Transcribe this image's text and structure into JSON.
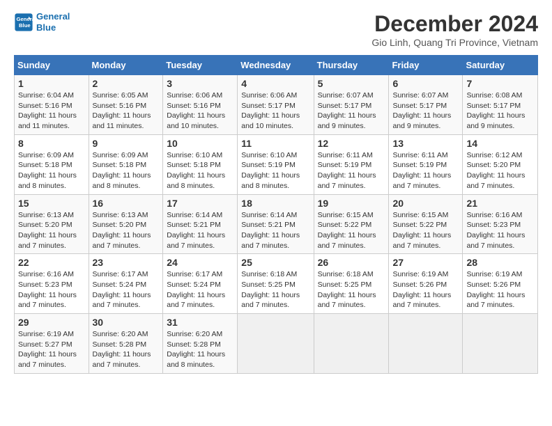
{
  "header": {
    "logo_line1": "General",
    "logo_line2": "Blue",
    "title": "December 2024",
    "subtitle": "Gio Linh, Quang Tri Province, Vietnam"
  },
  "weekdays": [
    "Sunday",
    "Monday",
    "Tuesday",
    "Wednesday",
    "Thursday",
    "Friday",
    "Saturday"
  ],
  "weeks": [
    [
      {
        "day": "1",
        "detail": "Sunrise: 6:04 AM\nSunset: 5:16 PM\nDaylight: 11 hours and 11 minutes."
      },
      {
        "day": "2",
        "detail": "Sunrise: 6:05 AM\nSunset: 5:16 PM\nDaylight: 11 hours and 11 minutes."
      },
      {
        "day": "3",
        "detail": "Sunrise: 6:06 AM\nSunset: 5:16 PM\nDaylight: 11 hours and 10 minutes."
      },
      {
        "day": "4",
        "detail": "Sunrise: 6:06 AM\nSunset: 5:17 PM\nDaylight: 11 hours and 10 minutes."
      },
      {
        "day": "5",
        "detail": "Sunrise: 6:07 AM\nSunset: 5:17 PM\nDaylight: 11 hours and 9 minutes."
      },
      {
        "day": "6",
        "detail": "Sunrise: 6:07 AM\nSunset: 5:17 PM\nDaylight: 11 hours and 9 minutes."
      },
      {
        "day": "7",
        "detail": "Sunrise: 6:08 AM\nSunset: 5:17 PM\nDaylight: 11 hours and 9 minutes."
      }
    ],
    [
      {
        "day": "8",
        "detail": "Sunrise: 6:09 AM\nSunset: 5:18 PM\nDaylight: 11 hours and 8 minutes."
      },
      {
        "day": "9",
        "detail": "Sunrise: 6:09 AM\nSunset: 5:18 PM\nDaylight: 11 hours and 8 minutes."
      },
      {
        "day": "10",
        "detail": "Sunrise: 6:10 AM\nSunset: 5:18 PM\nDaylight: 11 hours and 8 minutes."
      },
      {
        "day": "11",
        "detail": "Sunrise: 6:10 AM\nSunset: 5:19 PM\nDaylight: 11 hours and 8 minutes."
      },
      {
        "day": "12",
        "detail": "Sunrise: 6:11 AM\nSunset: 5:19 PM\nDaylight: 11 hours and 7 minutes."
      },
      {
        "day": "13",
        "detail": "Sunrise: 6:11 AM\nSunset: 5:19 PM\nDaylight: 11 hours and 7 minutes."
      },
      {
        "day": "14",
        "detail": "Sunrise: 6:12 AM\nSunset: 5:20 PM\nDaylight: 11 hours and 7 minutes."
      }
    ],
    [
      {
        "day": "15",
        "detail": "Sunrise: 6:13 AM\nSunset: 5:20 PM\nDaylight: 11 hours and 7 minutes."
      },
      {
        "day": "16",
        "detail": "Sunrise: 6:13 AM\nSunset: 5:20 PM\nDaylight: 11 hours and 7 minutes."
      },
      {
        "day": "17",
        "detail": "Sunrise: 6:14 AM\nSunset: 5:21 PM\nDaylight: 11 hours and 7 minutes."
      },
      {
        "day": "18",
        "detail": "Sunrise: 6:14 AM\nSunset: 5:21 PM\nDaylight: 11 hours and 7 minutes."
      },
      {
        "day": "19",
        "detail": "Sunrise: 6:15 AM\nSunset: 5:22 PM\nDaylight: 11 hours and 7 minutes."
      },
      {
        "day": "20",
        "detail": "Sunrise: 6:15 AM\nSunset: 5:22 PM\nDaylight: 11 hours and 7 minutes."
      },
      {
        "day": "21",
        "detail": "Sunrise: 6:16 AM\nSunset: 5:23 PM\nDaylight: 11 hours and 7 minutes."
      }
    ],
    [
      {
        "day": "22",
        "detail": "Sunrise: 6:16 AM\nSunset: 5:23 PM\nDaylight: 11 hours and 7 minutes."
      },
      {
        "day": "23",
        "detail": "Sunrise: 6:17 AM\nSunset: 5:24 PM\nDaylight: 11 hours and 7 minutes."
      },
      {
        "day": "24",
        "detail": "Sunrise: 6:17 AM\nSunset: 5:24 PM\nDaylight: 11 hours and 7 minutes."
      },
      {
        "day": "25",
        "detail": "Sunrise: 6:18 AM\nSunset: 5:25 PM\nDaylight: 11 hours and 7 minutes."
      },
      {
        "day": "26",
        "detail": "Sunrise: 6:18 AM\nSunset: 5:25 PM\nDaylight: 11 hours and 7 minutes."
      },
      {
        "day": "27",
        "detail": "Sunrise: 6:19 AM\nSunset: 5:26 PM\nDaylight: 11 hours and 7 minutes."
      },
      {
        "day": "28",
        "detail": "Sunrise: 6:19 AM\nSunset: 5:26 PM\nDaylight: 11 hours and 7 minutes."
      }
    ],
    [
      {
        "day": "29",
        "detail": "Sunrise: 6:19 AM\nSunset: 5:27 PM\nDaylight: 11 hours and 7 minutes."
      },
      {
        "day": "30",
        "detail": "Sunrise: 6:20 AM\nSunset: 5:28 PM\nDaylight: 11 hours and 7 minutes."
      },
      {
        "day": "31",
        "detail": "Sunrise: 6:20 AM\nSunset: 5:28 PM\nDaylight: 11 hours and 8 minutes."
      },
      {
        "day": "",
        "detail": ""
      },
      {
        "day": "",
        "detail": ""
      },
      {
        "day": "",
        "detail": ""
      },
      {
        "day": "",
        "detail": ""
      }
    ]
  ]
}
